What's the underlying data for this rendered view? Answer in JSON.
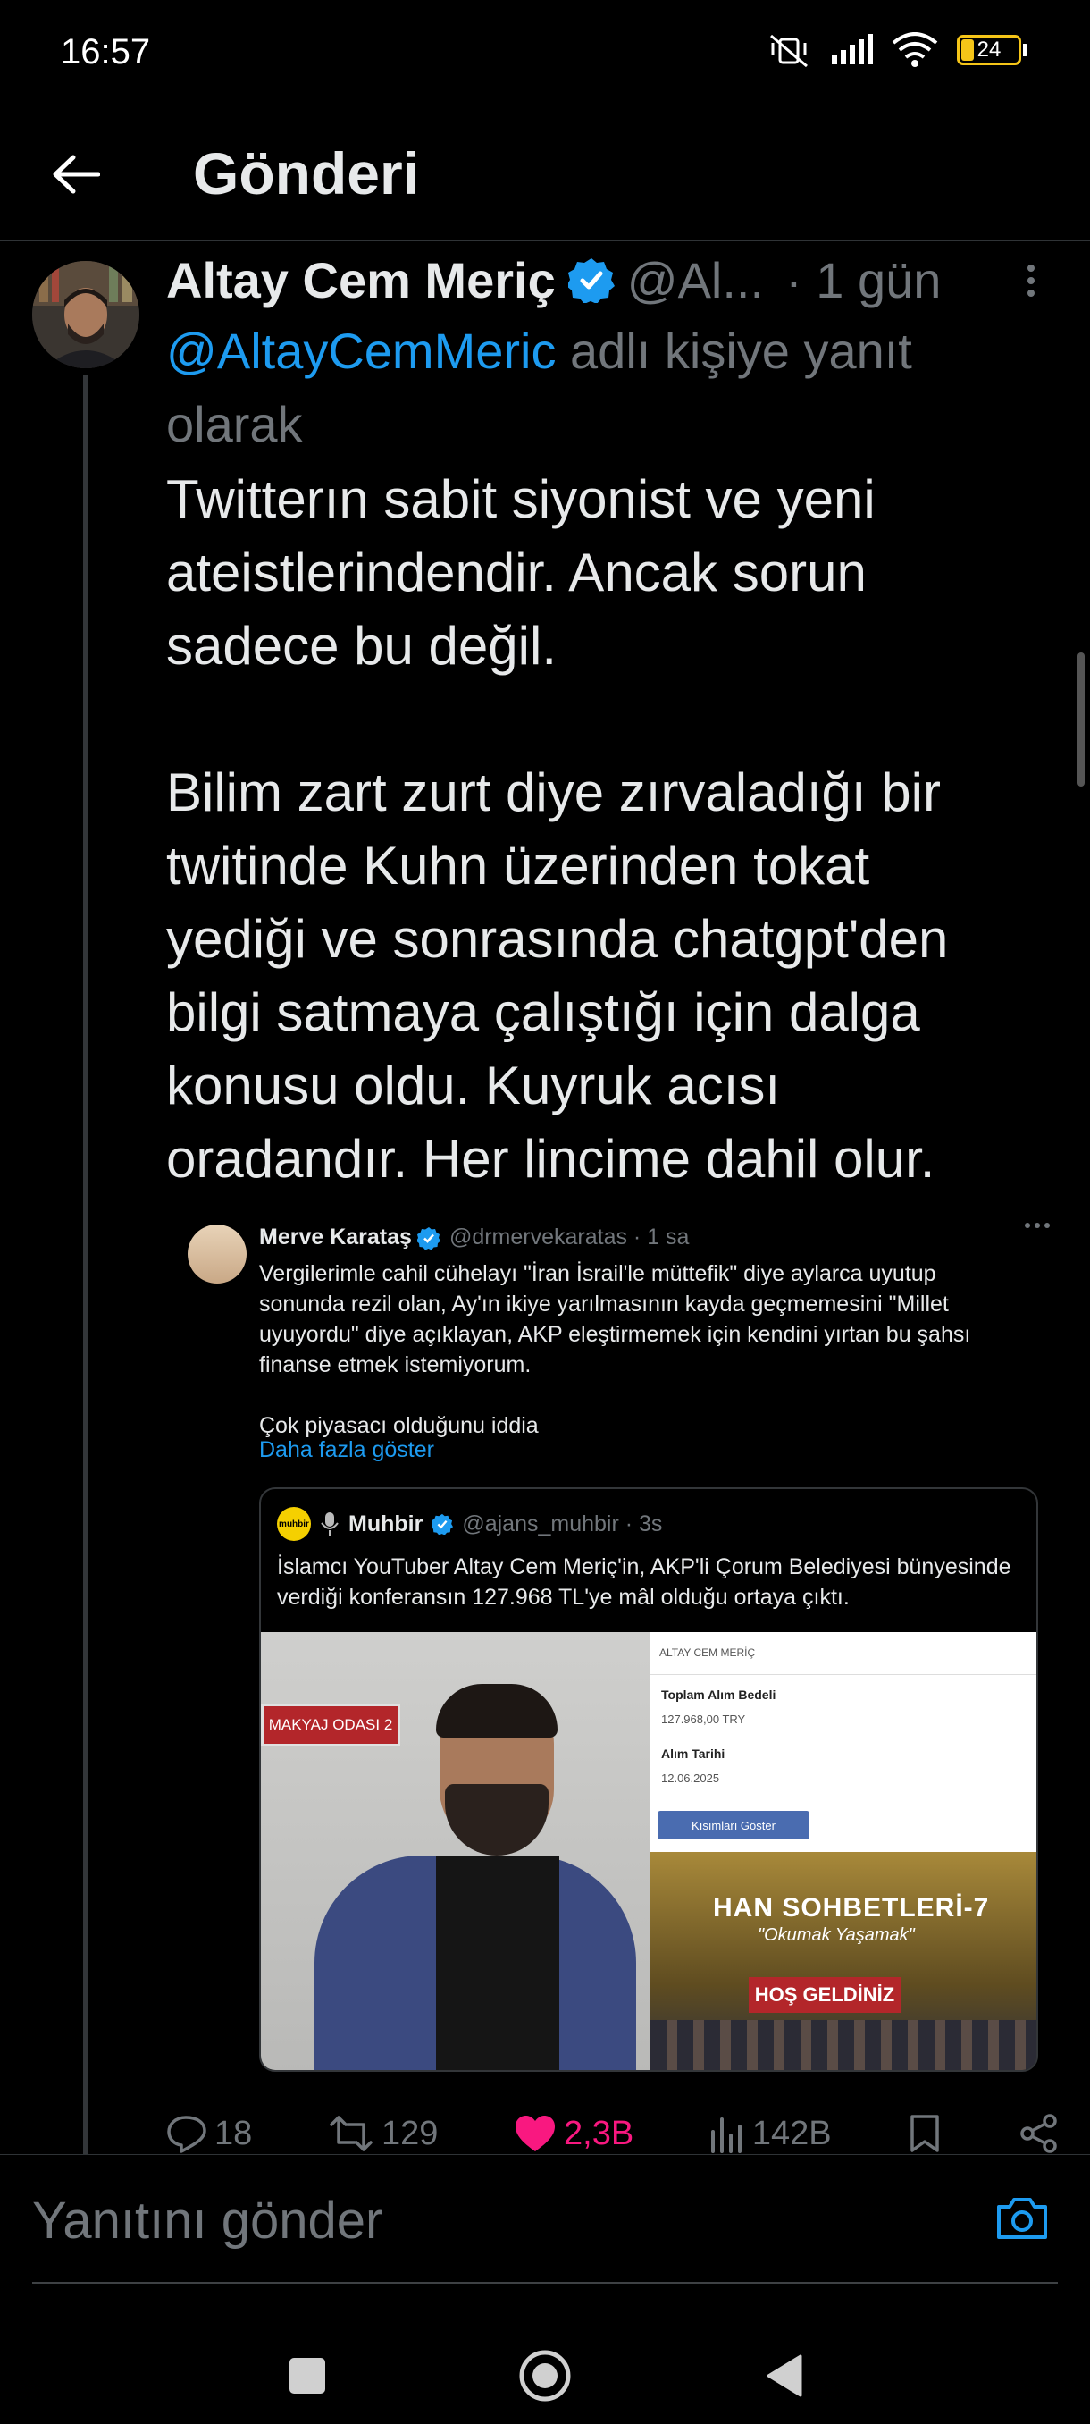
{
  "status_bar": {
    "time": "16:57",
    "battery": "24",
    "icons": [
      "mute-vibrate-icon",
      "signal-icon",
      "wifi-icon",
      "battery-icon"
    ]
  },
  "header": {
    "title": "Gönderi",
    "back_icon": "arrow-left-icon"
  },
  "tweet": {
    "author_name": "Altay Cem Meriç",
    "handle": "@Al...",
    "time": "· 1 gün",
    "reply_mention": "@AltayCemMeric",
    "reply_suffix": " adlı kişiye yanıt olarak",
    "text": "Twitterın sabit siyonist ve yeni ateistlerindendir. Ancak sorun sadece bu değil.\n\nBilim zart zurt diye zırvaladığı bir twitinde Kuhn üzerinden tokat yediği ve sonrasında chatgpt'den bilgi satmaya çalıştığı için dalga konusu oldu. Kuyruk acısı oradandır. Her lincime dahil olur."
  },
  "quoted_image": {
    "name": "Merve Karataş",
    "handle": "@drmervekaratas · 1 sa",
    "text": "Vergilerimle cahil cühelayı \"İran İsrail'le müttefik\" diye aylarca uyutup sonunda rezil olan, Ay'ın ikiye yarılmasının kayda geçmemesini \"Millet uyuyordu\" diye açıklayan, AKP eleştirmemek için kendini yırtan bu şahsı finanse etmek istemiyorum.\n\nÇok piyasacı olduğunu iddia",
    "show_more": "Daha fazla göster",
    "inner": {
      "logo": "muhbir",
      "name": "Muhbir",
      "handle": "@ajans_muhbir · 3s",
      "text": "İslamcı YouTuber Altay Cem Meriç'in, AKP'li Çorum Belediyesi bünyesinde verdiği konferansın 127.968 TL'ye mâl olduğu ortaya çıktı.",
      "photo_sign": "MAKYAJ ODASI 2",
      "panel_header": "ALTAY CEM MERİÇ",
      "field1_label": "Toplam Alım Bedeli",
      "field1_value": "127.968,00 TRY",
      "field2_label": "Alım Tarihi",
      "field2_value": "12.06.2025",
      "panel_button": "Kısımları Göster",
      "event_title": "HAN SOHBETLERİ-7",
      "event_sub": "\"Okumak Yaşamak\"",
      "event_banner": "HOŞ GELDİNİZ"
    }
  },
  "actions": {
    "replies": "18",
    "retweets": "129",
    "likes": "2,3B",
    "views": "142B"
  },
  "reply_bar": {
    "placeholder": "Yanıtını gönder"
  },
  "colors": {
    "accent": "#1d9bf0",
    "like": "#f91880",
    "muted": "#71767b",
    "background": "#000000"
  }
}
